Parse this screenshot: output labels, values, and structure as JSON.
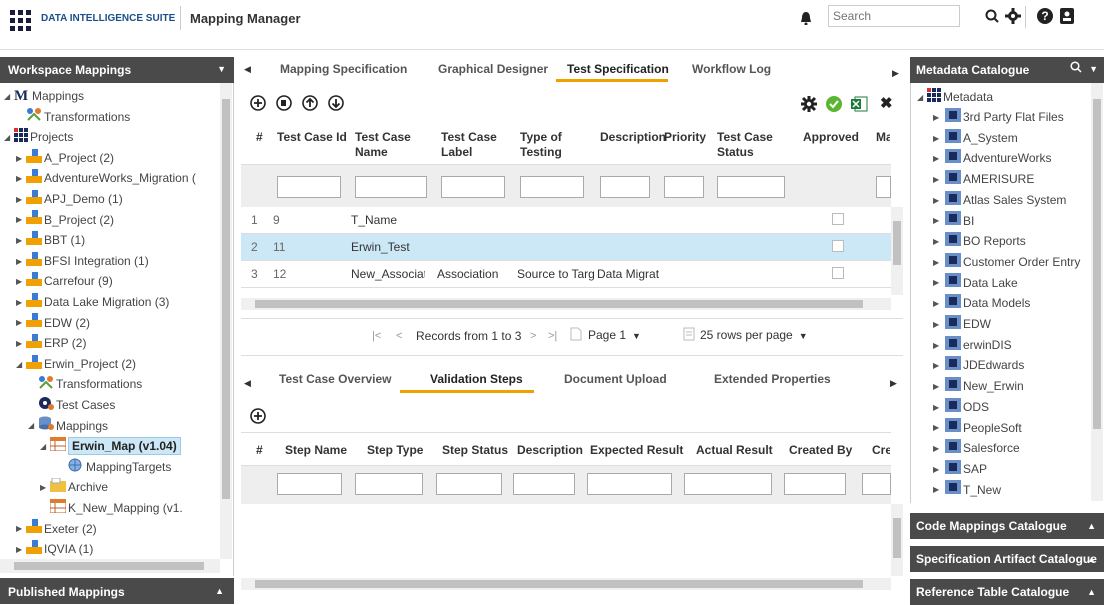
{
  "topbar": {
    "suite": "DATA INTELLIGENCE SUITE",
    "module": "Mapping Manager",
    "search_placeholder": "Search"
  },
  "left": {
    "title": "Workspace Mappings",
    "footer": "Published Mappings",
    "tree": [
      {
        "label": "Mappings"
      },
      {
        "label": "Transformations"
      },
      {
        "label": "Projects"
      },
      {
        "label": "A_Project (2)"
      },
      {
        "label": "AdventureWorks_Migration ("
      },
      {
        "label": "APJ_Demo (1)"
      },
      {
        "label": "B_Project (2)"
      },
      {
        "label": "BBT (1)"
      },
      {
        "label": "BFSI Integration (1)"
      },
      {
        "label": "Carrefour (9)"
      },
      {
        "label": "Data Lake Migration (3)"
      },
      {
        "label": "EDW (2)"
      },
      {
        "label": "ERP (2)"
      },
      {
        "label": "Erwin_Project (2)"
      },
      {
        "label": "Transformations"
      },
      {
        "label": "Test Cases"
      },
      {
        "label": "Mappings"
      },
      {
        "label": "Erwin_Map (v1.04)"
      },
      {
        "label": "MappingTargets"
      },
      {
        "label": "Archive"
      },
      {
        "label": "K_New_Mapping (v1."
      },
      {
        "label": "Exeter (2)"
      },
      {
        "label": "IQVIA (1)"
      }
    ]
  },
  "tabs": [
    "Mapping Specification",
    "Graphical Designer",
    "Test Specification",
    "Workflow Log"
  ],
  "grid": {
    "headers": [
      "#",
      "Test Case Id",
      "Test Case Name",
      "Test Case Label",
      "Type of Testing",
      "Description",
      "Priority",
      "Test Case Status",
      "Approved",
      "Map"
    ],
    "rows": [
      [
        "1",
        "9",
        "T_Name",
        "",
        "",
        "",
        "",
        "",
        ""
      ],
      [
        "2",
        "11",
        "Erwin_Test",
        "",
        "",
        "",
        "",
        "",
        ""
      ],
      [
        "3",
        "12",
        "New_Associatior",
        "Association",
        "Source to Targ",
        "Data Migrat",
        "",
        "",
        ""
      ]
    ]
  },
  "pager": {
    "records": "Records from 1 to 3",
    "page": "Page 1",
    "per_page": "25 rows per page"
  },
  "subtabs": [
    "Test Case Overview",
    "Validation Steps",
    "Document Upload",
    "Extended Properties"
  ],
  "steps": {
    "headers": [
      "#",
      "Step Name",
      "Step Type",
      "Step Status",
      "Description",
      "Expected Result",
      "Actual Result",
      "Created By",
      "Creat"
    ]
  },
  "right": {
    "title": "Metadata Catalogue",
    "root": "Metadata",
    "items": [
      "3rd Party Flat Files",
      "A_System",
      "AdventureWorks",
      "AMERISURE",
      "Atlas Sales System",
      "BI",
      "BO Reports",
      "Customer Order Entry",
      "Data Lake",
      "Data Models",
      "EDW",
      "erwinDIS",
      "JDEdwards",
      "New_Erwin",
      "ODS",
      "PeopleSoft",
      "Salesforce",
      "SAP",
      "T_New"
    ],
    "panels": [
      "Code Mappings Catalogue",
      "Specification Artifact Catalogue",
      "Reference Table Catalogue"
    ]
  },
  "colors": {
    "accent": "#f0a000",
    "header_bg": "#4a4a4a",
    "selected_row": "#cce8f7",
    "brand_blue": "#1a4f8b"
  }
}
